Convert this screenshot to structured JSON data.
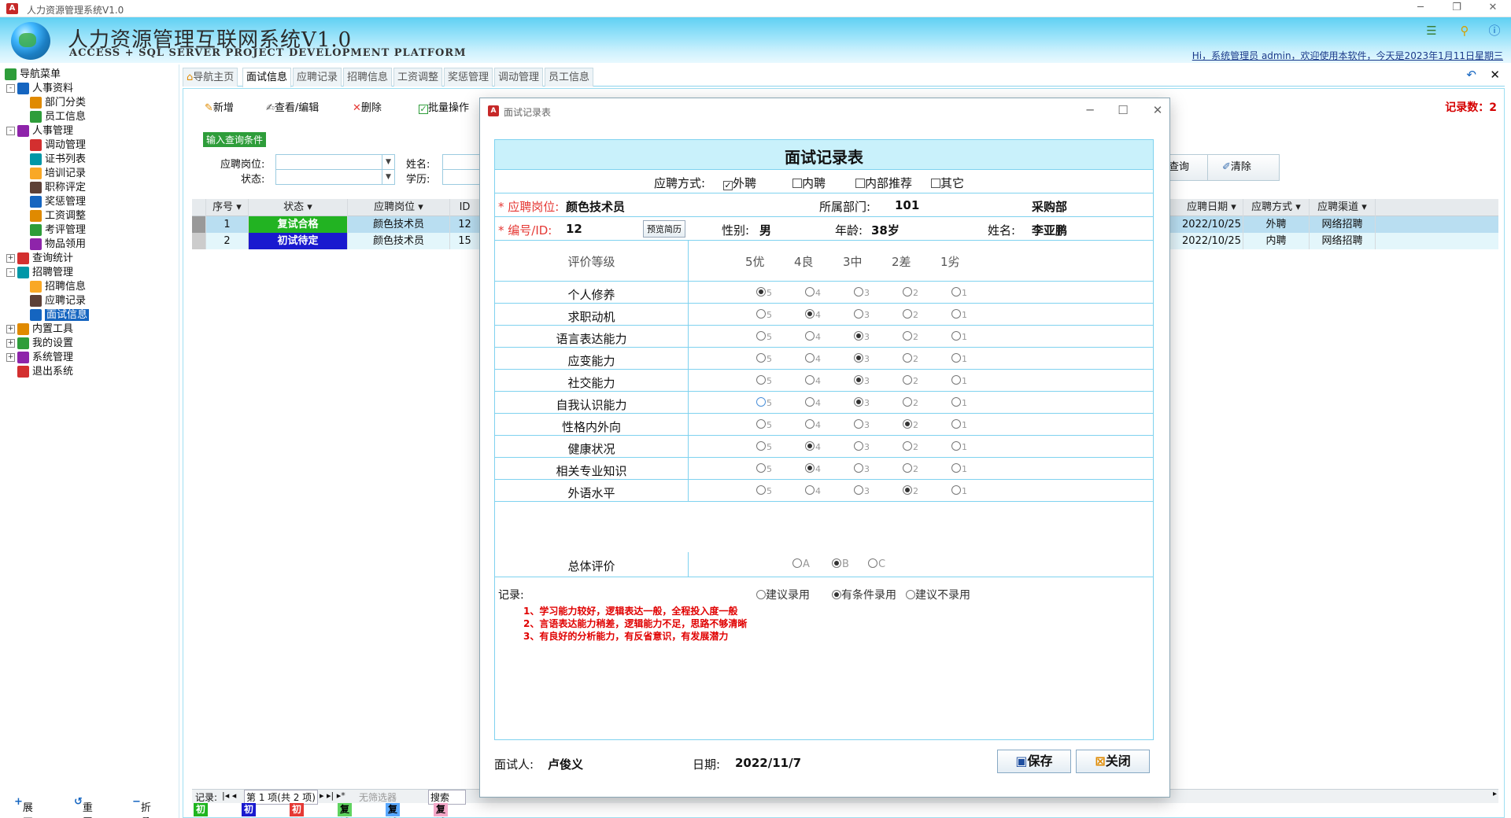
{
  "window": {
    "title": "人力资源管理系统V1.0"
  },
  "banner": {
    "title": "人力资源管理互联网系统V1.0",
    "subtitle": "ACCESS + SQL SERVER PROJECT DEVELOPMENT PLATFORM",
    "greeting": "Hi，系统管理员 admin，欢迎使用本软件，今天是2023年1月11日星期三"
  },
  "nav": {
    "root": "导航菜单",
    "items": [
      {
        "label": "人事资料",
        "level": 1,
        "expand": "-"
      },
      {
        "label": "部门分类",
        "level": 2
      },
      {
        "label": "员工信息",
        "level": 2
      },
      {
        "label": "人事管理",
        "level": 1,
        "expand": "-"
      },
      {
        "label": "调动管理",
        "level": 2
      },
      {
        "label": "证书列表",
        "level": 2
      },
      {
        "label": "培训记录",
        "level": 2
      },
      {
        "label": "职称评定",
        "level": 2
      },
      {
        "label": "奖惩管理",
        "level": 2
      },
      {
        "label": "工资调整",
        "level": 2
      },
      {
        "label": "考评管理",
        "level": 2
      },
      {
        "label": "物品领用",
        "level": 2
      },
      {
        "label": "查询统计",
        "level": 1,
        "expand": "+"
      },
      {
        "label": "招聘管理",
        "level": 1,
        "expand": "-"
      },
      {
        "label": "招聘信息",
        "level": 2
      },
      {
        "label": "应聘记录",
        "level": 2
      },
      {
        "label": "面试信息",
        "level": 2,
        "selected": true
      },
      {
        "label": "内置工具",
        "level": 1,
        "expand": "+"
      },
      {
        "label": "我的设置",
        "level": 1,
        "expand": "+"
      },
      {
        "label": "系统管理",
        "level": 1,
        "expand": "+"
      },
      {
        "label": "退出系统",
        "level": 1,
        "expand": ""
      }
    ],
    "footer": {
      "expand": "展开",
      "reset": "重置",
      "collapse": "折叠"
    }
  },
  "tabs": [
    "导航主页",
    "面试信息",
    "应聘记录",
    "招聘信息",
    "工资调整",
    "奖惩管理",
    "调动管理",
    "员工信息"
  ],
  "active_tab": 1,
  "toolbar": {
    "add": "新增",
    "view_edit": "查看/编辑",
    "delete": "删除",
    "batch": "批量操作"
  },
  "record_count": "记录数：2",
  "query": {
    "title": "输入查询条件",
    "position_label": "应聘岗位:",
    "status_label": "状态:",
    "name_label": "姓名:",
    "edu_label": "学历:",
    "search_btn": "查询",
    "clear_btn": "清除"
  },
  "grid": {
    "headers_left": [
      "序号",
      "状态",
      "应聘岗位",
      "ID"
    ],
    "headers_right": [
      "应聘日期",
      "应聘方式",
      "应聘渠道"
    ],
    "rows": [
      {
        "seq": "1",
        "status": "复试合格",
        "status_color": "#22b322",
        "position": "颜色技术员",
        "id": "12",
        "date": "2022/10/25",
        "method": "外聘",
        "channel": "网络招聘"
      },
      {
        "seq": "2",
        "status": "初试待定",
        "status_color": "#1a1acf",
        "position": "颜色技术员",
        "id": "15",
        "date": "2022/10/25",
        "method": "内聘",
        "channel": "网络招聘"
      }
    ],
    "footer": {
      "record_label": "记录:",
      "page_text": "第 1 项(共 2 项)",
      "filter": "无筛选器",
      "search": "搜索"
    }
  },
  "legend": [
    {
      "label": "初试合格",
      "bg": "#1fb51f",
      "fg": "#ffffff"
    },
    {
      "label": "初试待定",
      "bg": "#1a1acf",
      "fg": "#ffffff"
    },
    {
      "label": "初试淘汰",
      "bg": "#e53935",
      "fg": "#ffffff"
    },
    {
      "label": "复试合格",
      "bg": "#5fd35f",
      "fg": "#000000"
    },
    {
      "label": "复试待定",
      "bg": "#5aa9ff",
      "fg": "#000000"
    },
    {
      "label": "复试淘汰",
      "bg": "#f4a8c8",
      "fg": "#000000"
    }
  ],
  "dialog": {
    "window_title": "面试记录表",
    "form_title": "面试记录表",
    "method_label": "应聘方式:",
    "methods": [
      {
        "label": "外聘",
        "checked": true
      },
      {
        "label": "内聘",
        "checked": false
      },
      {
        "label": "内部推荐",
        "checked": false
      },
      {
        "label": "其它",
        "checked": false
      }
    ],
    "position_label": "* 应聘岗位:",
    "position": "颜色技术员",
    "dept_label": "所属部门:",
    "dept_id": "101",
    "dept_name": "采购部",
    "id_label": "* 编号/ID:",
    "id": "12",
    "preview_btn": "预览简历",
    "gender_label": "性别:",
    "gender": "男",
    "age_label": "年龄:",
    "age": "38岁",
    "name_label": "姓名:",
    "name": "李亚鹏",
    "grade_header": "评价等级",
    "grades": [
      "5优",
      "4良",
      "3中",
      "2差",
      "1劣"
    ],
    "criteria": [
      {
        "label": "个人修养",
        "value": 5
      },
      {
        "label": "求职动机",
        "value": 4
      },
      {
        "label": "语言表达能力",
        "value": 3
      },
      {
        "label": "应变能力",
        "value": 3
      },
      {
        "label": "社交能力",
        "value": 3
      },
      {
        "label": "自我认识能力",
        "value": 3
      },
      {
        "label": "性格内外向",
        "value": 2
      },
      {
        "label": "健康状况",
        "value": 4
      },
      {
        "label": "相关专业知识",
        "value": 4
      },
      {
        "label": "外语水平",
        "value": 2
      }
    ],
    "overall_label": "总体评价",
    "overall_options": [
      "A",
      "B",
      "C"
    ],
    "overall_value": "B",
    "record_label": "记录:",
    "recommend_options": [
      "建议录用",
      "有条件录用",
      "建议不录用"
    ],
    "recommend_value": "有条件录用",
    "notes": [
      "1、学习能力较好，逻辑表达一般，全程投入度一般",
      "2、言语表达能力稍差，逻辑能力不足，思路不够清晰",
      "3、有良好的分析能力，有反省意识，有发展潜力"
    ],
    "interviewer_label": "面试人:",
    "interviewer": "卢俊义",
    "date_label": "日期:",
    "date": "2022/11/7",
    "save_btn": "保存",
    "close_btn": "关闭"
  }
}
